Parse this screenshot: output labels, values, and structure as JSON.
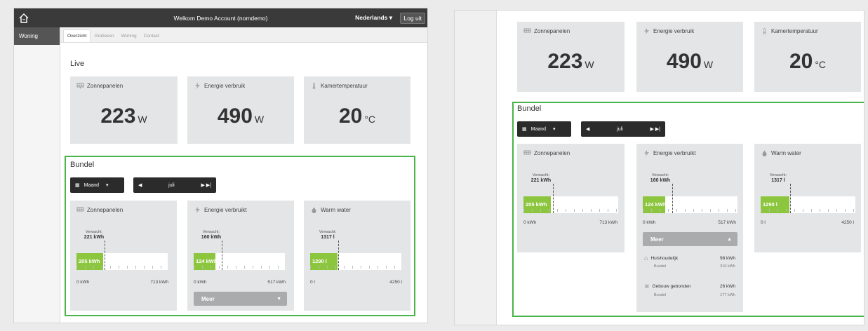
{
  "header": {
    "welcome": "Welkom Demo Account (nomdemo)",
    "language": "Nederlands",
    "logout": "Log uit"
  },
  "sidebar": {
    "items": [
      {
        "label": "Woning"
      }
    ]
  },
  "tabs": [
    {
      "label": "Overzicht",
      "active": true
    },
    {
      "label": "Grafieken"
    },
    {
      "label": "Woning"
    },
    {
      "label": "Contact"
    }
  ],
  "live": {
    "title": "Live",
    "cards": [
      {
        "label": "Zonnepanelen",
        "value": "223",
        "unit": "W",
        "icon": "solar-panel-icon"
      },
      {
        "label": "Energie verbruik",
        "value": "490",
        "unit": "W",
        "icon": "lightning-icon"
      },
      {
        "label": "Kamertemperatuur",
        "value": "20",
        "unit": "°C",
        "icon": "thermometer-icon"
      }
    ]
  },
  "bundel": {
    "title": "Bundel",
    "period_label": "Maand",
    "month": "juli",
    "cards": [
      {
        "label": "Zonnepanelen",
        "icon": "solar-panel-icon",
        "expected_label": "Verwacht:",
        "expected": "221 kWh",
        "current": "205 kWh",
        "min": "0 kWh",
        "max": "713 kWh",
        "fraction": 0.29,
        "expected_fraction": 0.31
      },
      {
        "label": "Energie verbruikt",
        "icon": "lightning-icon",
        "expected_label": "Verwacht:",
        "expected": "160 kWh",
        "current": "124 kWh",
        "min": "0 kWh",
        "max": "517 kWh",
        "fraction": 0.24,
        "expected_fraction": 0.31
      },
      {
        "label": "Warm water",
        "icon": "water-drop-icon",
        "expected_label": "Verwacht:",
        "expected": "1317 l",
        "current": "1290 l",
        "min": "0 l",
        "max": "4250 l",
        "fraction": 0.3,
        "expected_fraction": 0.31
      }
    ],
    "meer": "Meer",
    "details": [
      {
        "label": "Huishoudelijk",
        "value": "98 kWh",
        "sub": "Bundel",
        "sub_value": "310 kWh",
        "icon": "house-icon"
      },
      {
        "label": "Gebouw gebonden",
        "value": "26 kWh",
        "sub": "Bundel",
        "sub_value": "177 kWh",
        "icon": "heat-icon"
      }
    ]
  },
  "colors": {
    "accent_green": "#4ab34a",
    "bar_green": "#8cc63f",
    "dark": "#3a3a3a"
  }
}
